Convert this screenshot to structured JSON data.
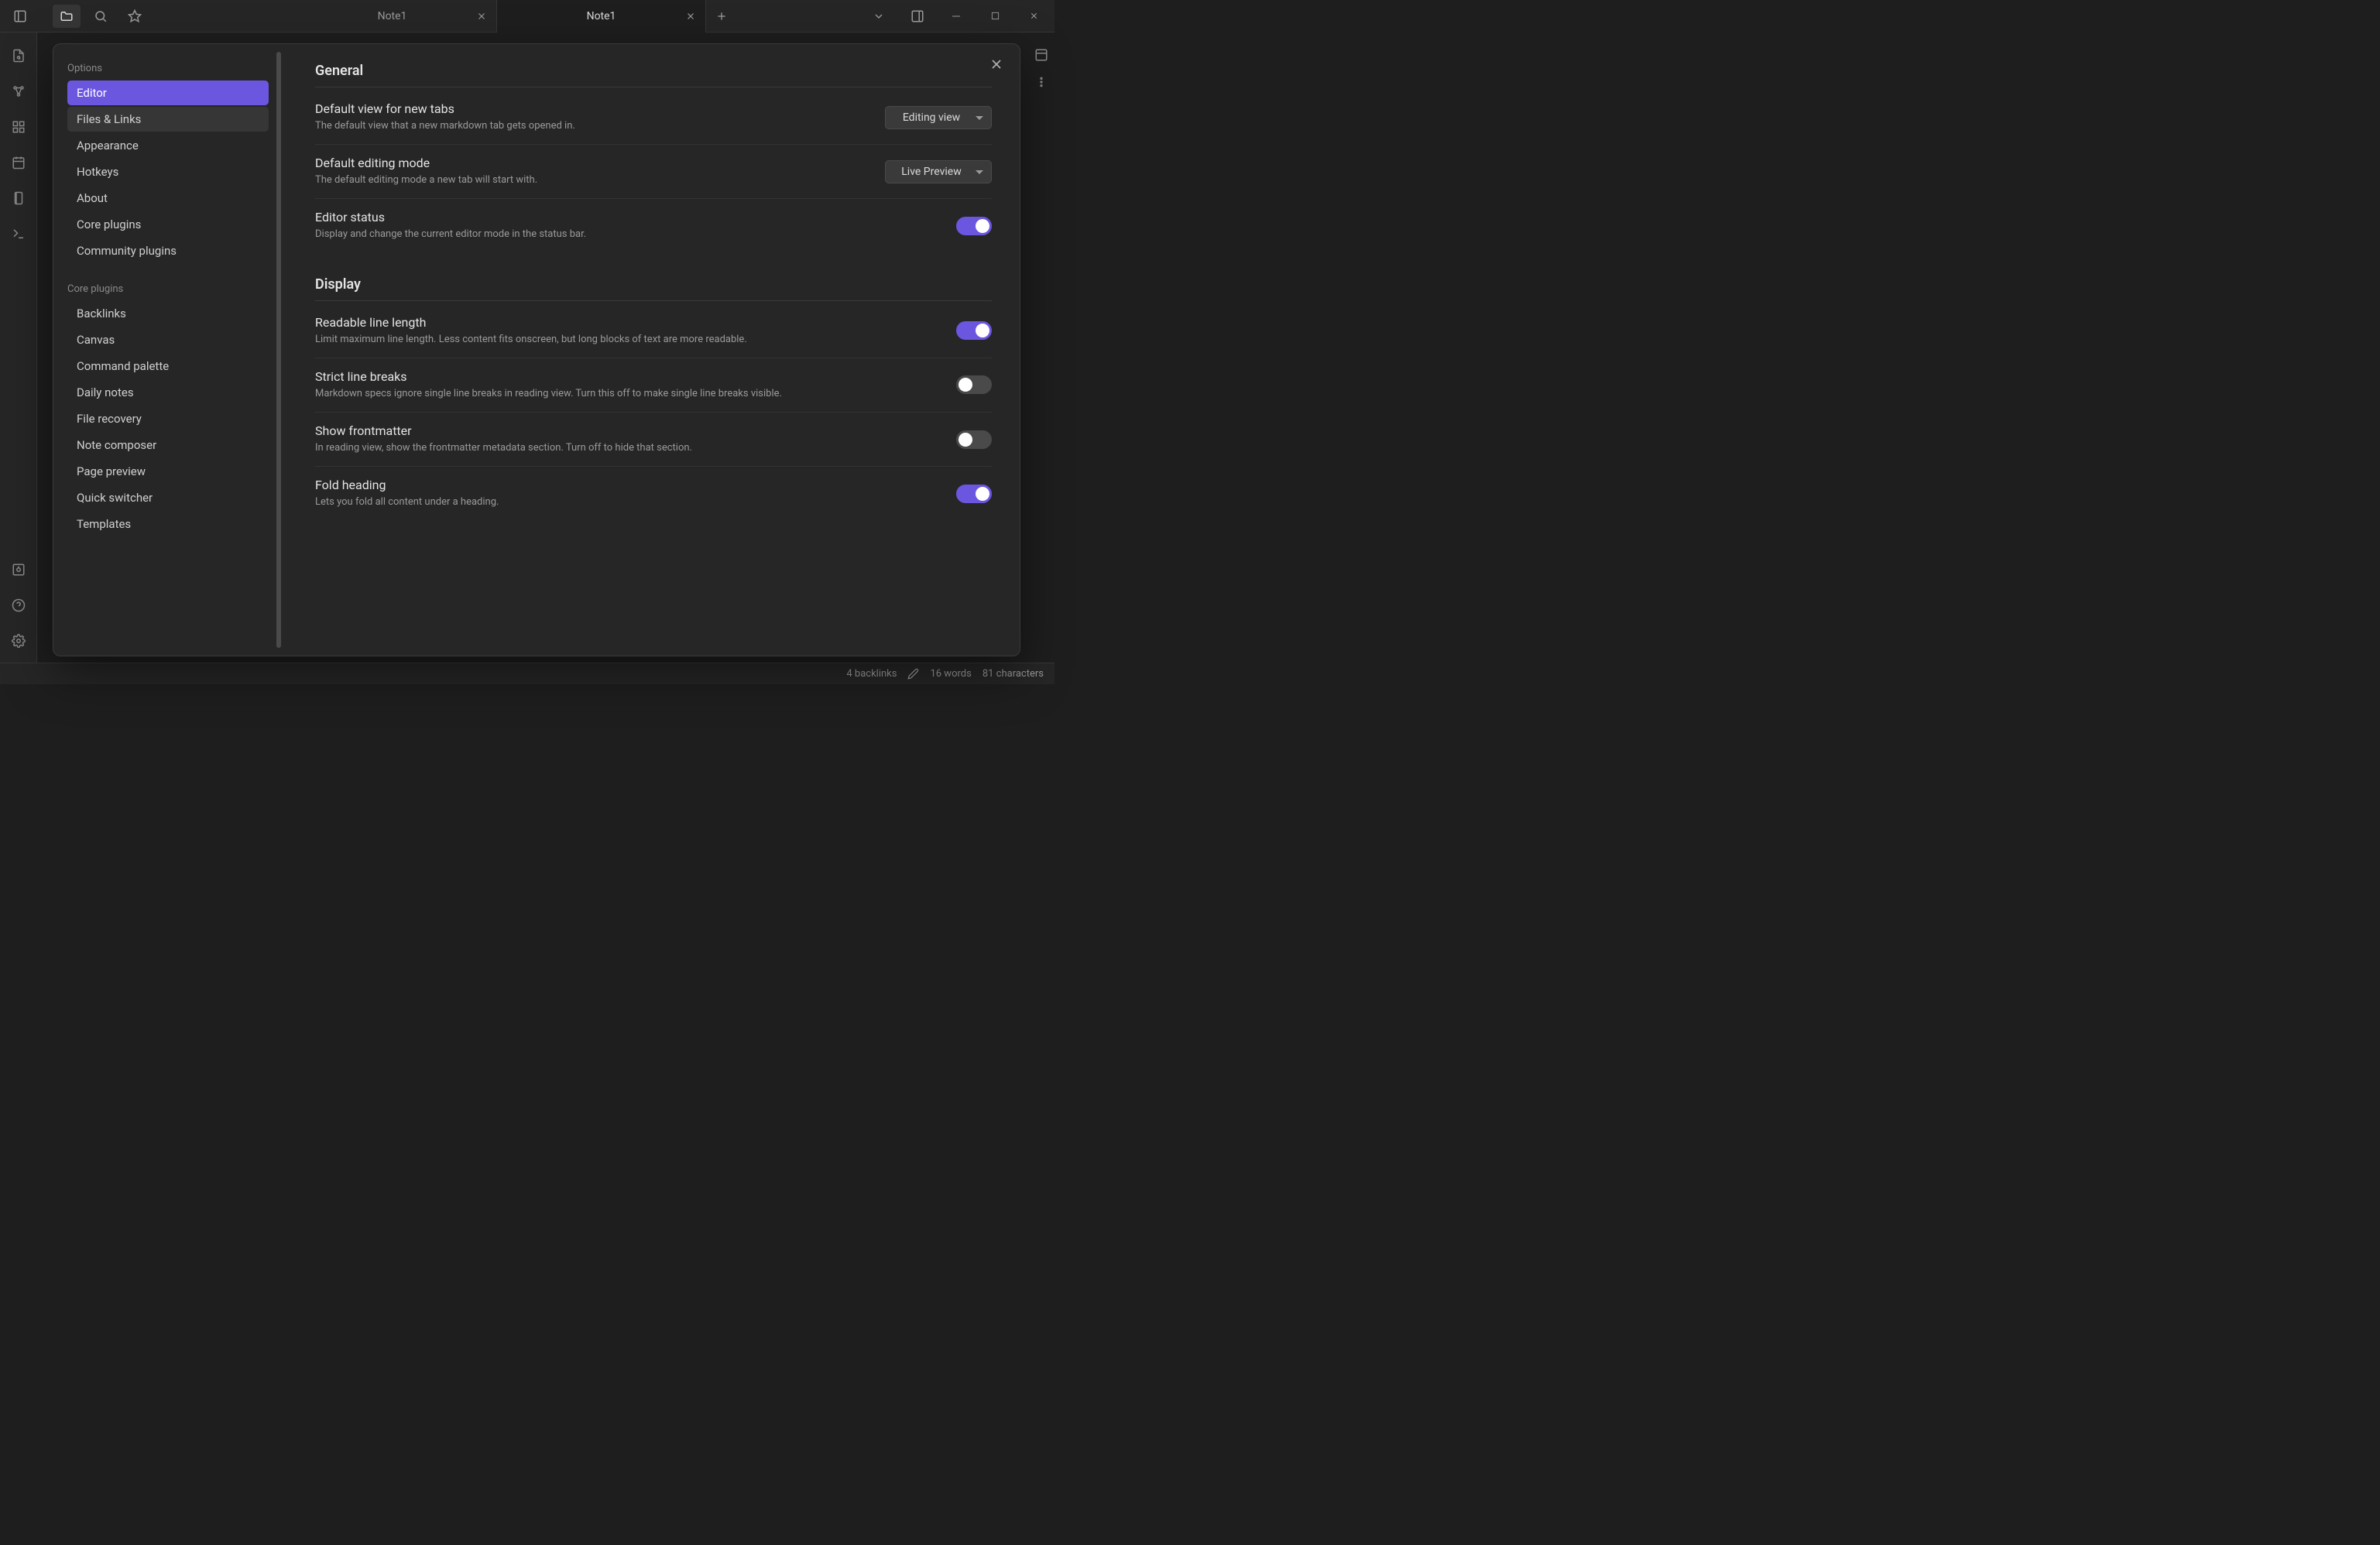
{
  "titlebar": {
    "tabs": [
      {
        "label": "Note1",
        "active": false
      },
      {
        "label": "Note1",
        "active": true
      }
    ]
  },
  "sidebar": {
    "heading_options": "Options",
    "options_items": [
      "Editor",
      "Files & Links",
      "Appearance",
      "Hotkeys",
      "About",
      "Core plugins",
      "Community plugins"
    ],
    "heading_core": "Core plugins",
    "core_items": [
      "Backlinks",
      "Canvas",
      "Command palette",
      "Daily notes",
      "File recovery",
      "Note composer",
      "Page preview",
      "Quick switcher",
      "Templates"
    ]
  },
  "settings": {
    "section_general": "General",
    "section_display": "Display",
    "rows": {
      "default_view": {
        "name": "Default view for new tabs",
        "desc": "The default view that a new markdown tab gets opened in.",
        "value": "Editing view"
      },
      "default_mode": {
        "name": "Default editing mode",
        "desc": "The default editing mode a new tab will start with.",
        "value": "Live Preview"
      },
      "editor_status": {
        "name": "Editor status",
        "desc": "Display and change the current editor mode in the status bar."
      },
      "readable_line": {
        "name": "Readable line length",
        "desc": "Limit maximum line length. Less content fits onscreen, but long blocks of text are more readable."
      },
      "strict_breaks": {
        "name": "Strict line breaks",
        "desc": "Markdown specs ignore single line breaks in reading view. Turn this off to make single line breaks visible."
      },
      "frontmatter": {
        "name": "Show frontmatter",
        "desc": "In reading view, show the frontmatter metadata section. Turn off to hide that section."
      },
      "fold_heading": {
        "name": "Fold heading",
        "desc": "Lets you fold all content under a heading."
      }
    }
  },
  "status": {
    "backlinks": "4 backlinks",
    "words": "16 words",
    "chars": "81 characters"
  }
}
